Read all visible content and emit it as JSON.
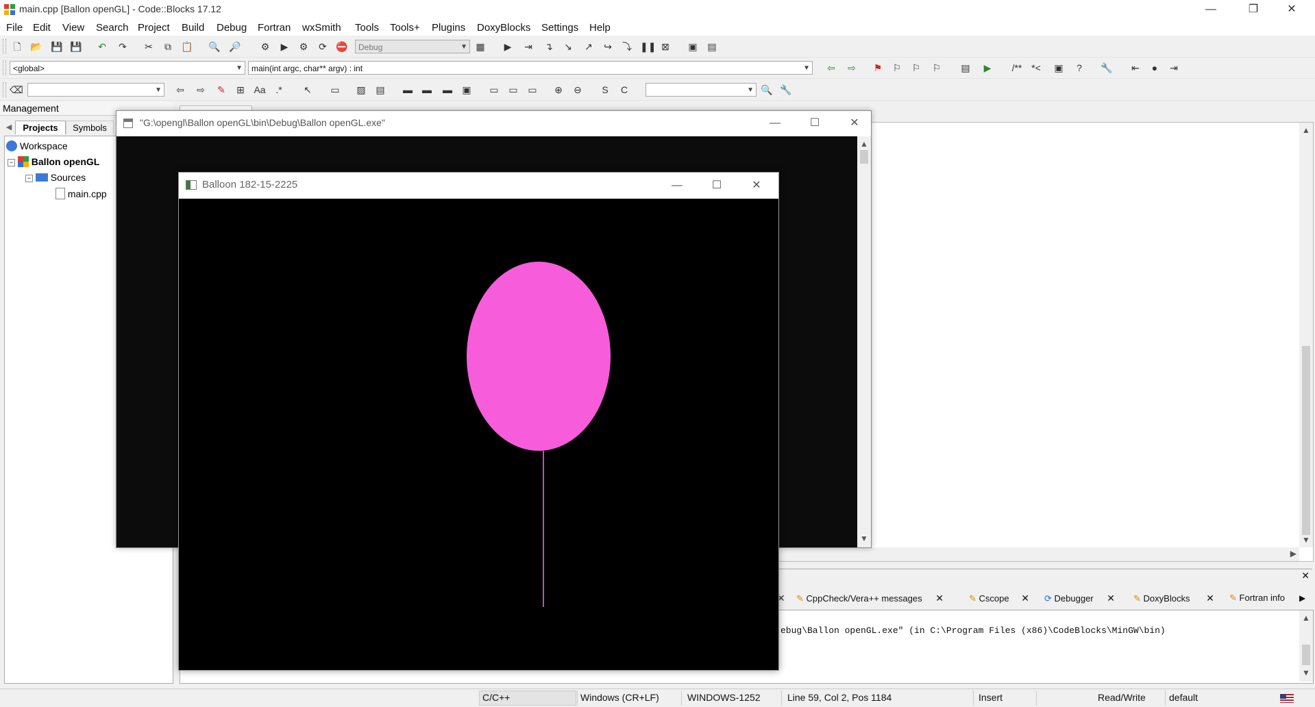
{
  "window": {
    "title": "main.cpp [Ballon openGL] - Code::Blocks 17.12",
    "controls": {
      "minimize": "—",
      "maximize": "❐",
      "close": "✕"
    }
  },
  "menu": [
    "File",
    "Edit",
    "View",
    "Search",
    "Project",
    "Build",
    "Debug",
    "Fortran",
    "wxSmith",
    "Tools",
    "Tools+",
    "Plugins",
    "DoxyBlocks",
    "Settings",
    "Help"
  ],
  "toolbar": {
    "build_target": "Debug",
    "scope": "<global>",
    "function": "main(int argc, char** argv) : int",
    "search_text": "",
    "find_text": ""
  },
  "management": {
    "title": "Management",
    "tabs": [
      "Projects",
      "Symbols"
    ],
    "tree": {
      "workspace": "Workspace",
      "project": "Ballon openGL",
      "folder": "Sources",
      "file": "main.cpp"
    }
  },
  "console_window": {
    "title": "\"G:\\opengl\\Ballon openGL\\bin\\Debug\\Ballon openGL.exe\""
  },
  "gl_window": {
    "title": "Balloon 182-15-2225",
    "balloon_color": "#f75cdb",
    "string_color": "#c94cb4"
  },
  "logs": {
    "tabs": [
      "CppCheck/Vera++ messages",
      "Cscope",
      "Debugger",
      "DoxyBlocks",
      "Fortran info"
    ],
    "line": "ebug\\Ballon openGL.exe\"  (in C:\\Program Files (x86)\\CodeBlocks\\MinGW\\bin)"
  },
  "status": {
    "language": "C/C++",
    "line_endings": "Windows (CR+LF)",
    "encoding": "WINDOWS-1252",
    "position": "Line 59, Col 2, Pos 1184",
    "mode": "Insert",
    "access": "Read/Write",
    "profile": "default"
  }
}
